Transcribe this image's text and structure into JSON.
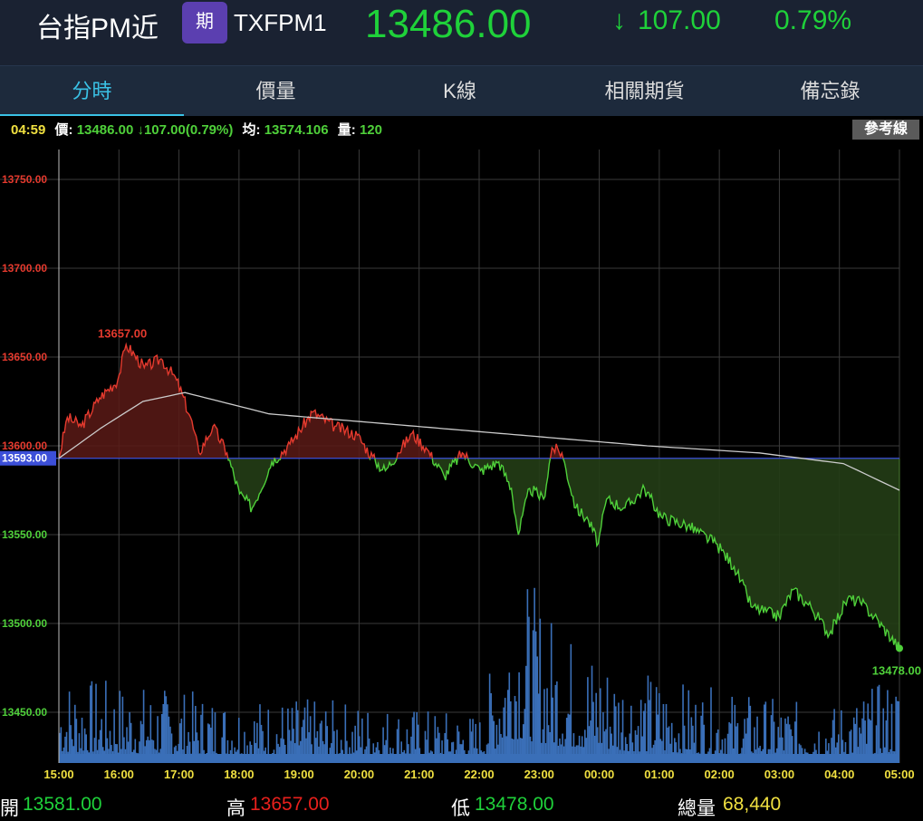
{
  "header": {
    "name": "台指PM近",
    "badge": "期",
    "code": "TXFPM1",
    "price": "13486.00",
    "change": "107.00",
    "change_arrow": "↓",
    "percent": "0.79%"
  },
  "tabs": [
    {
      "label": "分時",
      "active": true
    },
    {
      "label": "價量"
    },
    {
      "label": "K線"
    },
    {
      "label": "相關期貨"
    },
    {
      "label": "備忘錄"
    }
  ],
  "info": {
    "time": "04:59",
    "price_label": "價:",
    "price": "13486.00 ↓107.00(0.79%)",
    "avg_label": "均:",
    "avg": "13574.106",
    "vol_label": "量:",
    "vol": "120",
    "ref_button": "參考線"
  },
  "colors": {
    "up": "#e53a2e",
    "down": "#4fd03a",
    "base": "#3c4fd8",
    "volume": "#3a6fb8",
    "avg": "#cccccc",
    "time_label": "#f0e040"
  },
  "chart_data": {
    "type": "line",
    "base": 13593,
    "base_label": "13593.00",
    "ylim": [
      13420,
      13765
    ],
    "yticks": [
      "13750.00",
      "13700.00",
      "13650.00",
      "13600.00",
      "13550.00",
      "13500.00",
      "13450.00"
    ],
    "ytick_values": [
      13750,
      13700,
      13650,
      13600,
      13550,
      13500,
      13450
    ],
    "xticks": [
      "15:00",
      "16:00",
      "17:00",
      "18:00",
      "19:00",
      "20:00",
      "21:00",
      "22:00",
      "23:00",
      "00:00",
      "01:00",
      "02:00",
      "03:00",
      "04:00",
      "05:00"
    ],
    "high_label": "13657.00",
    "low_label": "13478.00",
    "price_minutes": [
      0,
      6,
      16,
      29,
      42,
      48,
      61,
      73,
      84,
      94,
      100,
      110,
      120,
      129,
      138,
      152,
      165,
      181,
      197,
      213,
      226,
      233,
      242,
      252,
      262,
      275,
      288,
      301,
      314,
      323,
      328,
      336,
      346,
      352,
      359,
      369,
      378,
      385,
      391,
      404,
      418,
      430,
      449,
      469,
      482,
      495,
      514,
      524,
      537,
      550,
      563,
      572,
      582,
      600
    ],
    "price": [
      13593,
      13616,
      13611,
      13627,
      13637,
      13657,
      13644,
      13649,
      13637,
      13616,
      13596,
      13611,
      13596,
      13573,
      13565,
      13591,
      13601,
      13619,
      13611,
      13606,
      13591,
      13586,
      13596,
      13607,
      13599,
      13583,
      13596,
      13586,
      13591,
      13576,
      13550,
      13576,
      13570,
      13599,
      13596,
      13565,
      13558,
      13545,
      13570,
      13565,
      13576,
      13560,
      13555,
      13545,
      13532,
      13509,
      13504,
      13519,
      13509,
      13494,
      13514,
      13512,
      13504,
      13486
    ],
    "avg_minutes": [
      0,
      30,
      60,
      90,
      150,
      240,
      330,
      420,
      500,
      560,
      600
    ],
    "avg": [
      13593,
      13610,
      13625,
      13630,
      13618,
      13612,
      13606,
      13600,
      13596,
      13590,
      13575
    ],
    "volume_minutes": [
      0,
      60,
      120,
      200,
      300,
      325,
      360,
      400,
      450,
      500,
      550,
      600
    ],
    "volume_level": [
      40,
      35,
      30,
      28,
      22,
      90,
      60,
      45,
      35,
      30,
      25,
      40
    ]
  },
  "footer": {
    "open_label": "開",
    "open": "13581.00",
    "high_label": "高",
    "high": "13657.00",
    "low_label": "低",
    "low": "13478.00",
    "total_label": "總量",
    "total": "68,440"
  }
}
